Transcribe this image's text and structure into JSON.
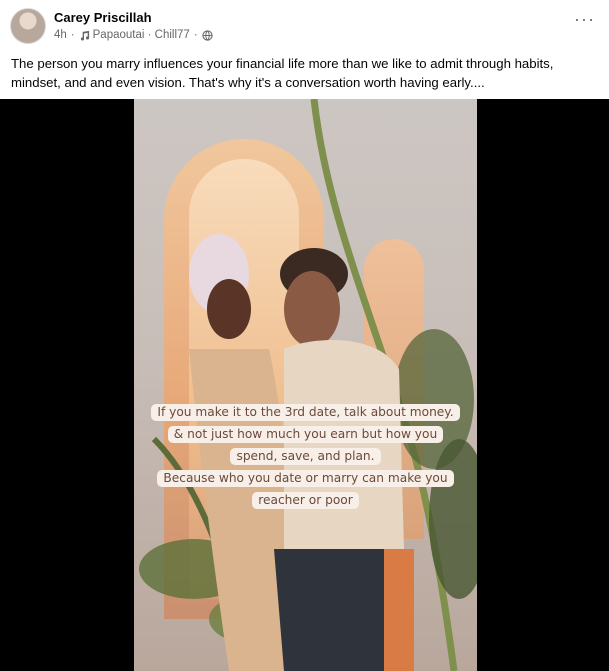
{
  "post": {
    "author": "Carey Priscillah",
    "time": "4h",
    "audio": "Papaoutai · Chill77",
    "more": "···",
    "caption": "The  person you marry influences your financial life more than we like to admit  through habits, mindset, and and even vision. That's why it's a conversation worth having early...."
  },
  "video": {
    "overlay_lines": [
      "If you make it to the 3rd date, talk about money.",
      "& not just  how much you earn but how you",
      "spend, save, and plan.",
      "Because who you date or marry can make you",
      "reacher or poor"
    ]
  },
  "icons": {
    "audio": "music-note-icon",
    "privacy": "globe-icon",
    "more": "more-options-icon"
  },
  "colors": {
    "name": "#050505",
    "meta": "#65676b",
    "overlay_bg": "#f7efe8",
    "overlay_text": "#6b4a3a",
    "letterbox": "#000000"
  }
}
